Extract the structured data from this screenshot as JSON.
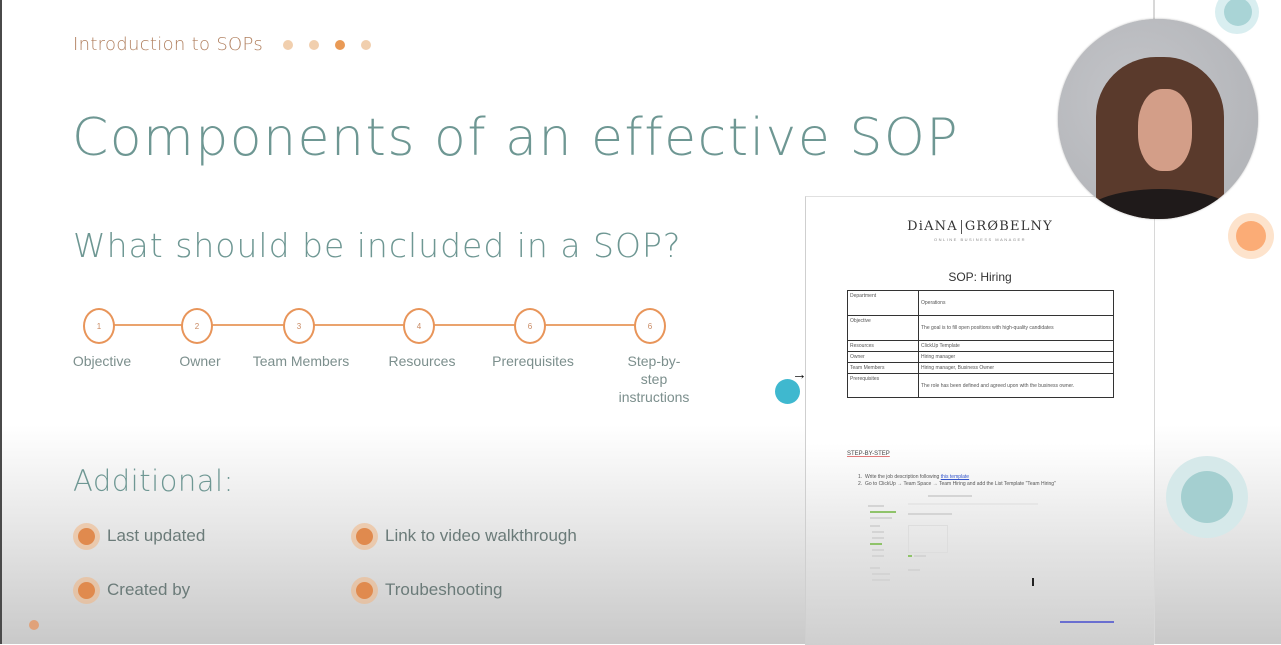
{
  "slide": {
    "section_label": "Introduction to SOPs",
    "progress": {
      "total": 4,
      "current": 3
    },
    "title": "Components of an effective SOP",
    "subtitle": "What should be included in a SOP?",
    "steps": [
      {
        "number": "1",
        "label": "Objective"
      },
      {
        "number": "2",
        "label": "Owner"
      },
      {
        "number": "3",
        "label": "Team Members"
      },
      {
        "number": "4",
        "label": "Resources"
      },
      {
        "number": "6",
        "label": "Prerequisites"
      },
      {
        "number": "6",
        "label": "Step-by-step\ninstructions"
      }
    ],
    "additional": {
      "heading": "Additional:",
      "items": [
        "Last updated",
        "Link to video walkthrough",
        "Created by",
        "Troubeshooting"
      ]
    }
  },
  "document": {
    "brand_left": "DiANA",
    "brand_right": "GRØBELNY",
    "brand_sub": "ONLINE BUSINESS MANAGER",
    "title": "SOP: Hiring",
    "table": [
      {
        "key": "Department",
        "value": "Operations"
      },
      {
        "key": "Objective",
        "value": "The goal is to fill open positions with high-quality candidates"
      },
      {
        "key": "Resources",
        "value": "ClickUp Template"
      },
      {
        "key": "Owner",
        "value": "Hiring manager"
      },
      {
        "key": "Team Members",
        "value": "Hiring manager, Business Owner"
      },
      {
        "key": "Prerequisites",
        "value": "The role has been defined and agreed upon with the business owner."
      }
    ],
    "step_heading": "STEP-BY-STEP",
    "steps": [
      {
        "prefix": "Write the job description following ",
        "link": "this template",
        "suffix": ""
      },
      {
        "prefix": "Go to ClickUp → Team Space → Team Hiring and add the List Template \"Team Hiring\"",
        "link": "",
        "suffix": ""
      }
    ]
  },
  "colors": {
    "accent_orange": "#e8955a",
    "heading_teal": "#6e9793",
    "label_brown": "#b07f5e",
    "cyan_dot": "#3fb8cf"
  }
}
